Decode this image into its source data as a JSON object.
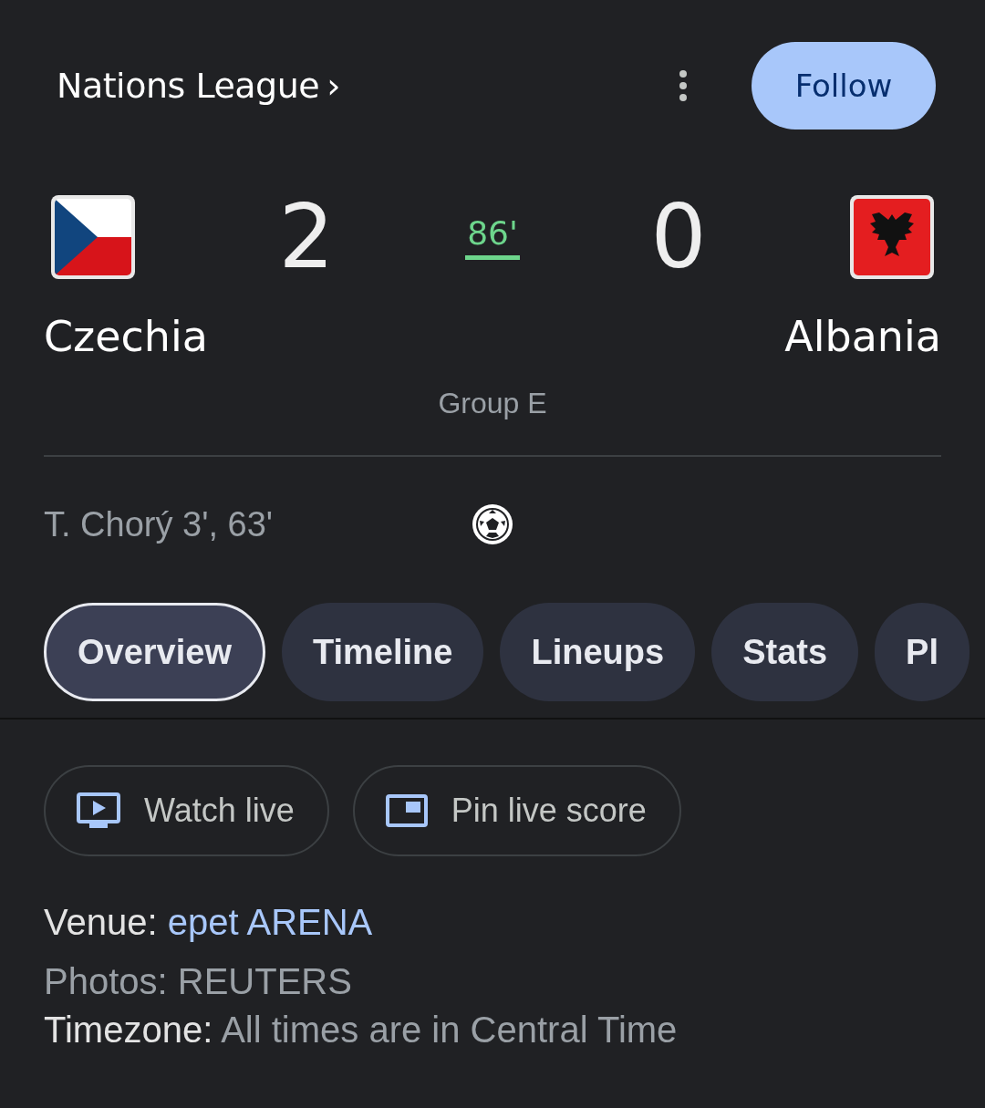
{
  "header": {
    "competition": "Nations League",
    "chevron": "›",
    "follow": "Follow"
  },
  "match": {
    "home": {
      "name": "Czechia",
      "score": "2"
    },
    "away": {
      "name": "Albania",
      "score": "0"
    },
    "minute": "86'",
    "group": "Group E"
  },
  "scorers": [
    {
      "text": "T. Chorý 3', 63'"
    }
  ],
  "tabs": [
    {
      "label": "Overview",
      "selected": true
    },
    {
      "label": "Timeline",
      "selected": false
    },
    {
      "label": "Lineups",
      "selected": false
    },
    {
      "label": "Stats",
      "selected": false
    },
    {
      "label": "Pl",
      "selected": false
    }
  ],
  "actions": [
    {
      "label": "Watch live",
      "kind": "watch"
    },
    {
      "label": "Pin live score",
      "kind": "pin"
    }
  ],
  "info": {
    "venue_label": "Venue:",
    "venue": "epet ARENA",
    "photos": "Photos: REUTERS",
    "timezone_label": "Timezone:",
    "timezone": "All times are in Central Time"
  }
}
